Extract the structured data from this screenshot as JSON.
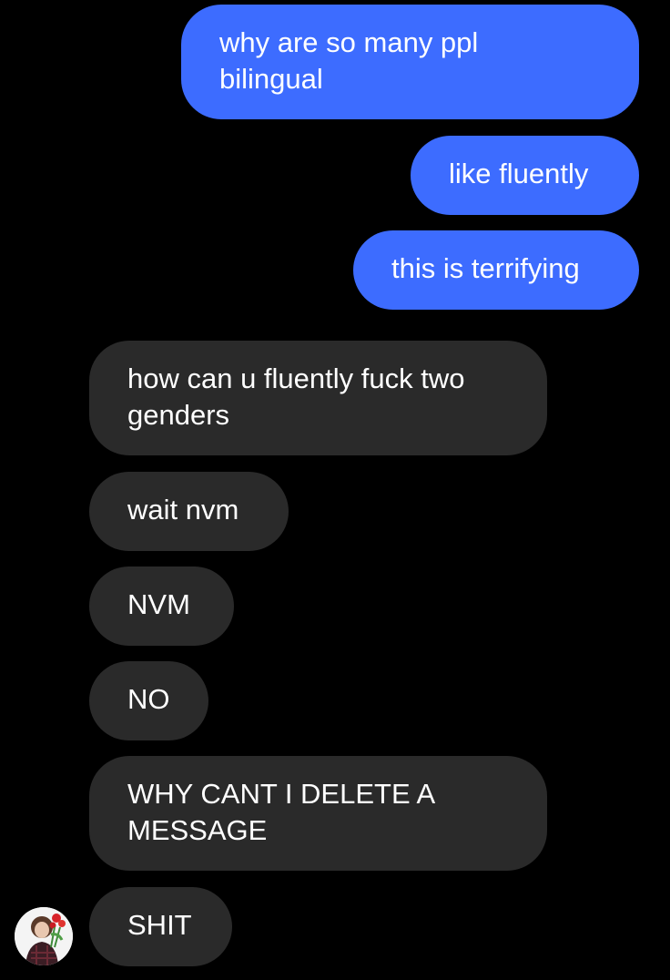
{
  "conversation": {
    "messages": [
      {
        "side": "sent",
        "text": "why are so many ppl\nbilingual"
      },
      {
        "side": "sent",
        "text": "like fluently"
      },
      {
        "side": "sent",
        "text": "this is terrifying"
      },
      {
        "side": "received",
        "text": "how can u fluently fuck two\ngenders"
      },
      {
        "side": "received",
        "text": "wait nvm"
      },
      {
        "side": "received",
        "text": "NVM"
      },
      {
        "side": "received",
        "text": "NO"
      },
      {
        "side": "received",
        "text": "WHY CANT I DELETE A\nMESSAGE"
      },
      {
        "side": "received",
        "text": "SHIT"
      }
    ],
    "contact_avatar_icon": "user-avatar-photo"
  },
  "colors": {
    "background": "#000000",
    "sent_bubble": "#3d6cff",
    "received_bubble": "#2a2a2a",
    "text": "#ffffff"
  }
}
